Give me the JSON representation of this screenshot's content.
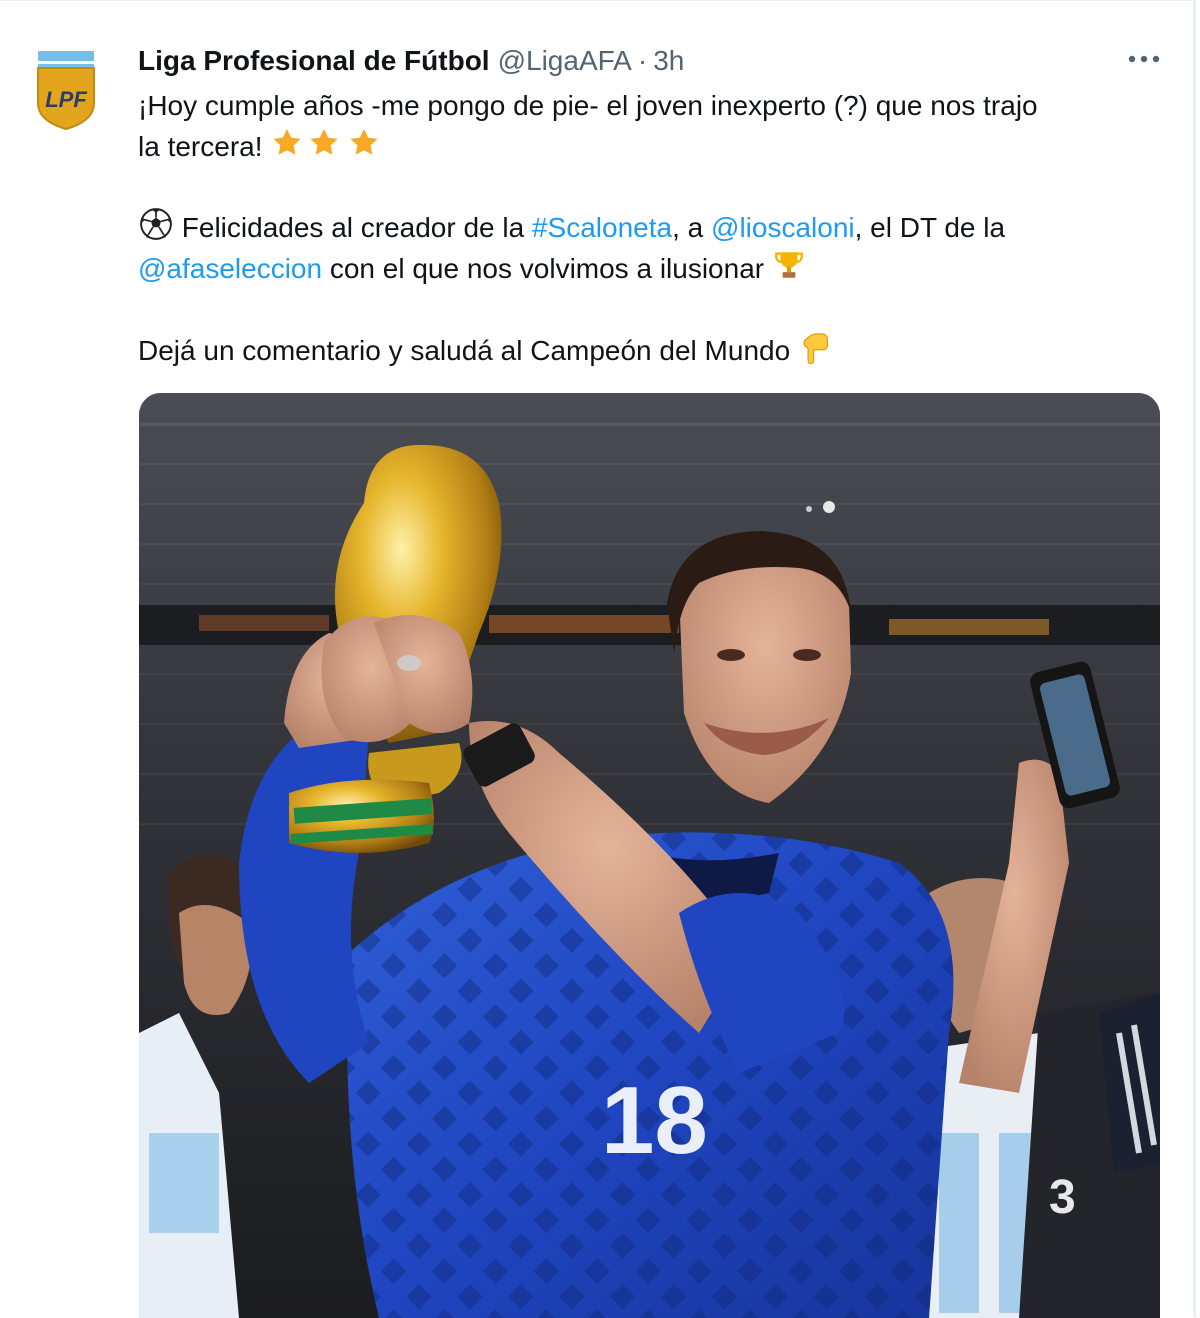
{
  "tweet": {
    "author": {
      "display_name": "Liga Profesional de Fútbol",
      "handle": "@LigaAFA",
      "logo_text": "LPF"
    },
    "separator": "·",
    "time": "3h",
    "more_icon": "more-horizontal-icon",
    "text": {
      "line1": "¡Hoy cumple años -me pongo de pie- el joven inexperto (?) que nos trajo",
      "line2": "la tercera!",
      "para2_prefix": "Felicidades al creador de la",
      "hashtag": "#Scaloneta",
      "para2_mid": ", a",
      "mention1": "@lioscaloni",
      "para2_suffix": ", el DT de la",
      "mention2": "@afaseleccion",
      "para2_line2_suffix": "con el que nos volvimos a ilusionar",
      "para3": "Dejá un comentario y saludá al Campeón del Mundo"
    },
    "emojis": [
      "star-icon",
      "star-icon",
      "star-icon",
      "soccer-ball-icon",
      "trophy-icon",
      "pointing-down-icon"
    ],
    "photo": {
      "jersey_number": "18",
      "description_icon": "photo"
    },
    "colors": {
      "link": "#1d9bf0",
      "text": "#0f1419",
      "secondary": "#536471"
    }
  }
}
